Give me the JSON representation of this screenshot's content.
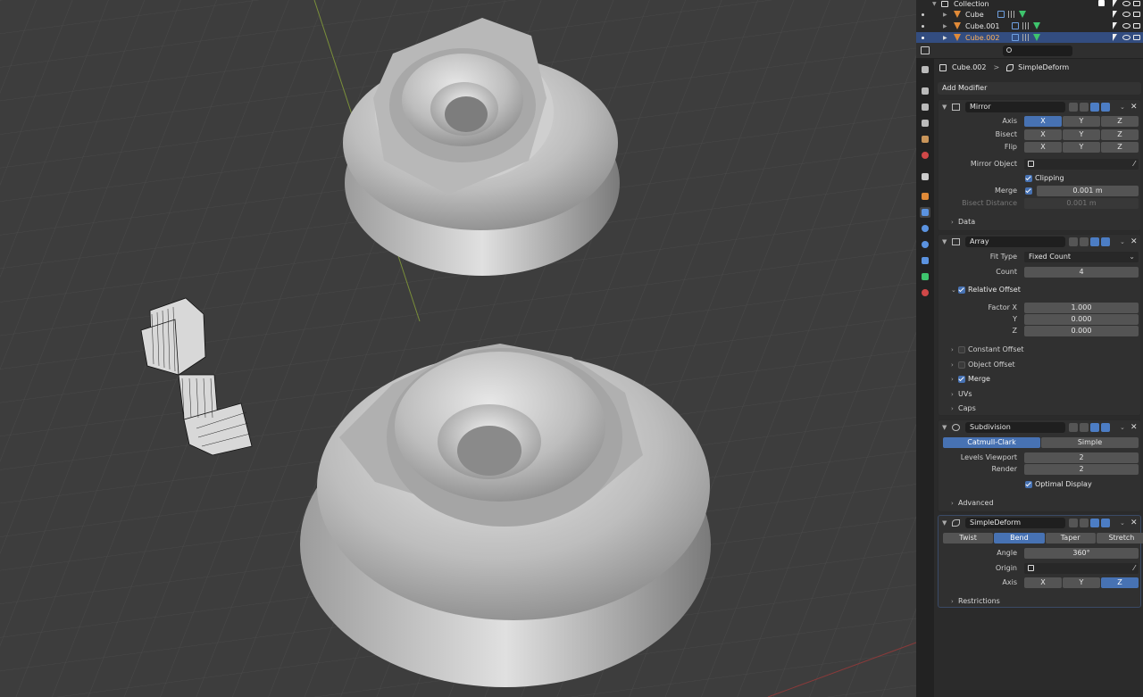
{
  "outliner": {
    "rows": [
      {
        "name": "Collection"
      },
      {
        "name": "Cube"
      },
      {
        "name": "Cube.001"
      },
      {
        "name": "Cube.002"
      }
    ]
  },
  "properties": {
    "breadcrumb": {
      "object": "Cube.002",
      "separator": ">",
      "modifier": "SimpleDeform"
    },
    "add_modifier": "Add Modifier",
    "mirror": {
      "name": "Mirror",
      "axis_label": "Axis",
      "bisect_label": "Bisect",
      "flip_label": "Flip",
      "x": "X",
      "y": "Y",
      "z": "Z",
      "mirror_object_label": "Mirror Object",
      "clipping_label": "Clipping",
      "merge_label": "Merge",
      "merge_value": "0.001 m",
      "bisect_distance_label": "Bisect Distance",
      "bisect_distance_value": "0.001 m",
      "data_label": "Data"
    },
    "array": {
      "name": "Array",
      "fit_type_label": "Fit Type",
      "fit_type_value": "Fixed Count",
      "count_label": "Count",
      "count_value": "4",
      "relative_offset_label": "Relative Offset",
      "factor_x_label": "Factor X",
      "factor_x_value": "1.000",
      "y_label": "Y",
      "y_value": "0.000",
      "z_label": "Z",
      "z_value": "0.000",
      "constant_offset_label": "Constant Offset",
      "object_offset_label": "Object Offset",
      "merge_label": "Merge",
      "uvs_label": "UVs",
      "caps_label": "Caps"
    },
    "subdivision": {
      "name": "Subdivision",
      "catmull_clark": "Catmull-Clark",
      "simple": "Simple",
      "levels_viewport_label": "Levels Viewport",
      "levels_viewport_value": "2",
      "render_label": "Render",
      "render_value": "2",
      "optimal_display_label": "Optimal Display",
      "advanced_label": "Advanced"
    },
    "simpledeform": {
      "name": "SimpleDeform",
      "twist": "Twist",
      "bend": "Bend",
      "taper": "Taper",
      "stretch": "Stretch",
      "angle_label": "Angle",
      "angle_value": "360°",
      "origin_label": "Origin",
      "axis_label": "Axis",
      "x": "X",
      "y": "Y",
      "z": "Z",
      "restrictions_label": "Restrictions"
    }
  },
  "colors": {
    "accent": "#4772b3",
    "selected_row": "#334d80",
    "object_icon": "#e08a38",
    "mesh_icon": "#3ec46d"
  }
}
